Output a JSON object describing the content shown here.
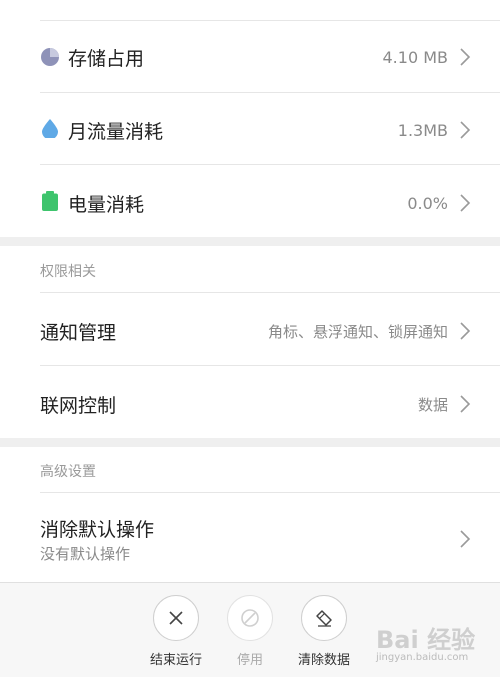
{
  "stats": {
    "storage": {
      "label": "存储占用",
      "value": "4.10 MB",
      "icon": "pie-chart-icon",
      "color": "#8e92b8"
    },
    "traffic": {
      "label": "月流量消耗",
      "value": "1.3MB",
      "icon": "water-drop-icon",
      "color": "#5fa9e6"
    },
    "battery": {
      "label": "电量消耗",
      "value": "0.0%",
      "icon": "battery-icon",
      "color": "#3ec46d"
    }
  },
  "permissions": {
    "title": "权限相关",
    "notification": {
      "label": "通知管理",
      "value": "角标、悬浮通知、锁屏通知"
    },
    "network": {
      "label": "联网控制",
      "value": "数据"
    }
  },
  "advanced": {
    "title": "高级设置",
    "default_action": {
      "label": "消除默认操作",
      "sub": "没有默认操作"
    }
  },
  "actions": {
    "stop": {
      "label": "结束运行",
      "icon": "close-icon"
    },
    "disable": {
      "label": "停用",
      "icon": "disable-icon"
    },
    "clear": {
      "label": "清除数据",
      "icon": "eraser-icon"
    }
  },
  "watermark": {
    "text": "Bai 经验",
    "url": "jingyan.baidu.com"
  }
}
